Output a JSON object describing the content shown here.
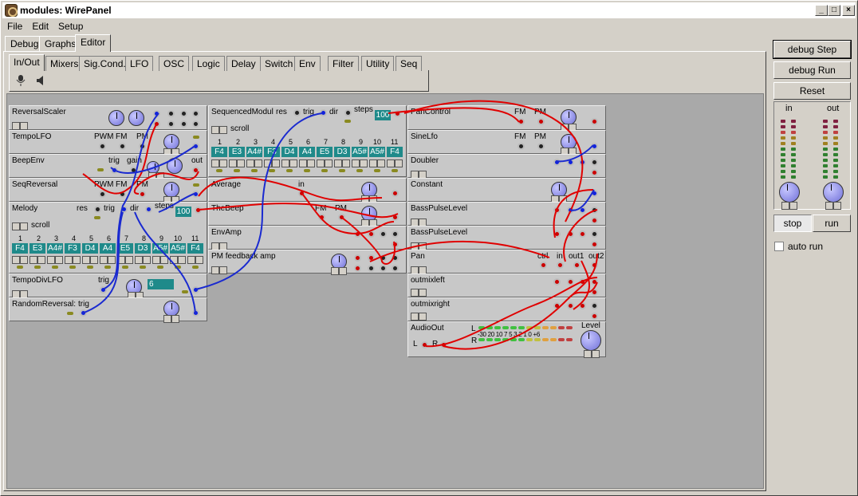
{
  "window": {
    "title": "modules: WirePanel",
    "minimize": "_",
    "maximize": "□",
    "close": "×"
  },
  "menu": [
    {
      "label": "File",
      "key": "F"
    },
    {
      "label": "Edit",
      "key": "E"
    },
    {
      "label": "Setup",
      "key": "S"
    }
  ],
  "outer_tabs": [
    "Debug",
    "Graphs",
    "Editor"
  ],
  "inner_tabs": [
    "In/Out",
    "Mixers",
    "Sig.Cond.",
    "LFO",
    "OSC",
    "Logic",
    "Delay",
    "Switch",
    "Env",
    "Filter",
    "Utility",
    "Seq"
  ],
  "palette_icons": [
    "microphone-icon",
    "speaker-icon"
  ],
  "modules": {
    "reversal_scaler": "ReversalScaler",
    "tempo_lfo": "TempoLFO",
    "beep_env": "BeepEnv",
    "seq_reversal": "SeqReversal",
    "melody": "Melody",
    "tempo_div_lfo": "TempoDivLFO",
    "random_reversal": "RandomReversal:",
    "sequenced_modul": "SequencedModul",
    "average": "Average",
    "the_beep": "TheBeep",
    "env_amp": "EnvAmp",
    "pm_feedback_amp": "PM feedback amp",
    "pan_control": "PanControl",
    "sine_lfo": "SineLfo",
    "doubler": "Doubler",
    "constant": "Constant",
    "bass_pulse_level_1": "BassPulseLevel",
    "bass_pulse_level_2": "BassPulseLevel",
    "pan": "Pan",
    "outmixleft": "outmixleft",
    "outmixright": "outmixright",
    "audio_out": "AudioOut"
  },
  "labels": {
    "pwm": "PWM",
    "fm": "FM",
    "pm": "PM",
    "trig": "trig",
    "gain": "gain",
    "out": "out",
    "res": "res",
    "dir": "dir",
    "steps": "steps",
    "scroll": "scroll",
    "in": "in",
    "ctrl": "ctrl",
    "out1": "out1",
    "out2": "out2",
    "L": "L",
    "R": "R",
    "level": "Level",
    "db_scale": "-30 20 10 7  5  3  2  1  0  +6",
    "steps_value": "100",
    "tempo_div_value": "6"
  },
  "seq_numbers": [
    "1",
    "2",
    "3",
    "4",
    "5",
    "6",
    "7",
    "8",
    "9",
    "10",
    "11"
  ],
  "melody_cells": [
    "F4",
    "E3",
    "A4#",
    "F3",
    "D4",
    "A4",
    "E5",
    "D3",
    "A5#",
    "A5#",
    "F4"
  ],
  "seqmod_cells": [
    "F4",
    "E3",
    "A4#",
    "F3",
    "D4",
    "A4",
    "E5",
    "D3",
    "A5#",
    "A5#",
    "F4"
  ],
  "right_panel": {
    "debug_step": "debug Step",
    "debug_run": "debug Run",
    "reset": "Reset",
    "in": "in",
    "out": "out",
    "stop": "stop",
    "run": "run",
    "auto_run": "auto run"
  },
  "colors": {
    "wire_red": "#e00000",
    "wire_blue": "#1a2ad0",
    "seq_cell": "#1f8a8a",
    "canvas": "#a9a9a9",
    "module": "#c8c8c8"
  }
}
